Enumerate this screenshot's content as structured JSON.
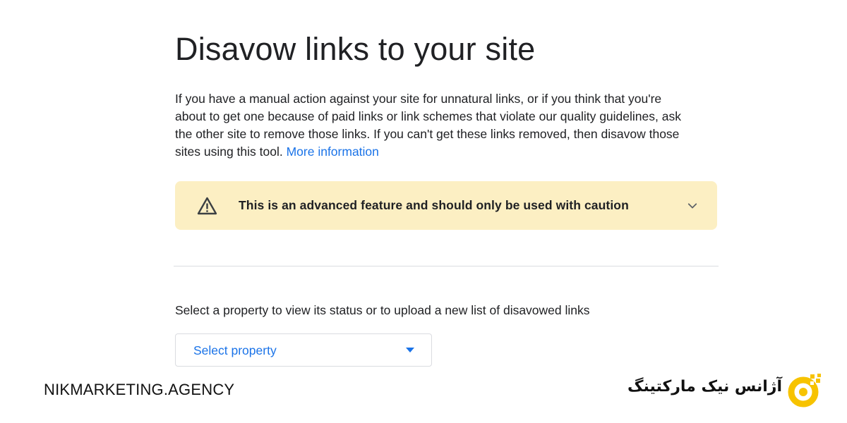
{
  "page": {
    "title": "Disavow links to your site",
    "intro_text": "If you have a manual action against your site for unnatural links, or if you think that you're about to get one because of paid links or link schemes that violate our quality guidelines, ask the other site to remove those links. If you can't get these links removed, then disavow those sites using this tool.",
    "more_info_link": "More information"
  },
  "warning": {
    "text": "This is an advanced feature and should only be used with caution",
    "icon": "warning-triangle-icon",
    "background": "#fcefc3"
  },
  "property": {
    "label": "Select a property to view its status or to upload a new list of disavowed links",
    "select_value": "Select property"
  },
  "branding": {
    "left_text": "NIKMARKETING.AGENCY",
    "right_text": "آژانس نیک مارکتینگ",
    "logo_color": "#f7c300"
  },
  "colors": {
    "link": "#1a73e8",
    "text": "#202124",
    "divider": "#dadce0"
  }
}
